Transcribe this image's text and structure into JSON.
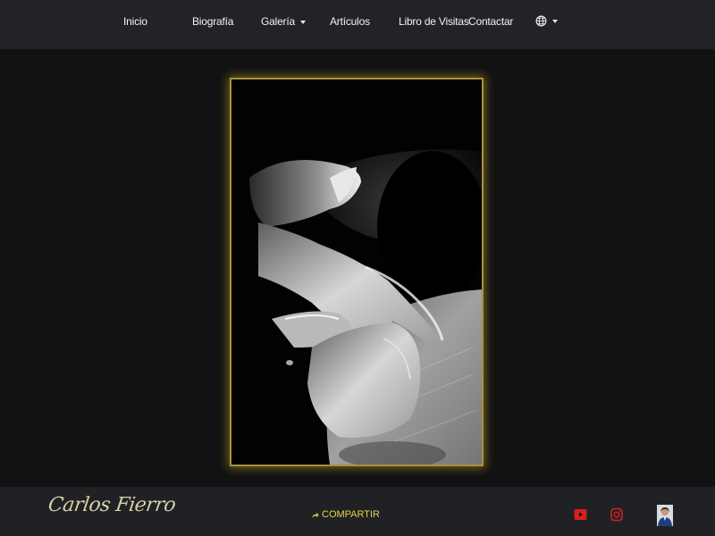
{
  "nav": {
    "inicio": "Inicio",
    "biografia": "Biografía",
    "galeria": "Galería",
    "articulos": "Artículos",
    "libro": "Libro de Visitas",
    "contactar": "Contactar"
  },
  "icons": {
    "language": "globe-icon",
    "share": "share-icon",
    "youtube": "youtube-icon",
    "instagram": "instagram-icon"
  },
  "colors": {
    "accent_gold": "#a8913a",
    "share_yellow": "#e6d34a",
    "social_red": "#d81e1e"
  },
  "footer": {
    "signature": "Carlos Fierro",
    "share_label": "COMPARTIR"
  }
}
